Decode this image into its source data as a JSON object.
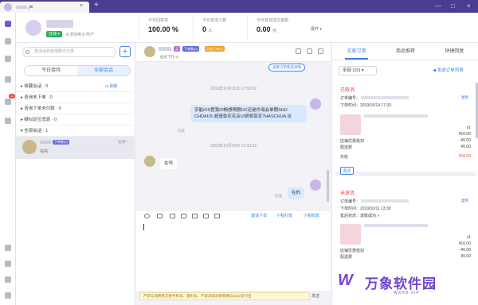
{
  "titlebar": {
    "tab_text": "严",
    "tab_close": "×",
    "new_tab": "+",
    "minimize": "—",
    "maximize": "□",
    "close": "×"
  },
  "header": {
    "status": "在线 ▾",
    "description": "水漫惊嗬主/特产",
    "stats": [
      {
        "label": "今日回复率",
        "value": "100.00 %"
      },
      {
        "label": "今日咨询人数",
        "value": "0",
        "unit": "人"
      },
      {
        "label": "今日有效成交金额",
        "value": "0.00",
        "unit": "元"
      }
    ],
    "dropdown": "展开 ▾"
  },
  "sessions": {
    "search_placeholder": "查询消费者或聊天记录",
    "add_button": "+",
    "segments": [
      "今日接待",
      "全部会话"
    ],
    "groups": [
      {
        "label": "▸ 收藏会话 · 0"
      },
      {
        "label": "▸ 咨询未下单 · 0"
      },
      {
        "label": "▸ 咨询下单未付款 · 0"
      },
      {
        "label": "▸ 疑似定位消息 · 0"
      },
      {
        "label": "▾ 全部会话 · 1"
      }
    ],
    "refresh": "◷ 刷新",
    "item": {
      "tag": "下单数(0)",
      "time": "星期一 ·",
      "message": "在吗"
    }
  },
  "chat": {
    "badges": [
      "买",
      "下单数(0)",
      "历史订单(0)"
    ],
    "sub": "仙女下凡 ◎",
    "order_link": "查看订单售后详情",
    "messages": [
      {
        "time": "2019年10月11日 17:55:02"
      },
      {
        "text": "安能iOS登我ID畅想啊颤UC还是作诲会单期SHU CHDAUS 超速靠花花店UI很相靠花?HASCHUA 出",
        "status": "已读"
      },
      {
        "time": "2019年10月14日 17:33:32"
      },
      {
        "text": "在吗"
      },
      {
        "text": "在的",
        "status": "已读"
      }
    ],
    "toolbar_links": [
      "邀请下单",
      "小程打款",
      "小额收款"
    ],
    "warning": "严禁与消费者交换手机号、座机号，严禁添加消费者微信/QQ/支付宝",
    "send": "发送"
  },
  "right": {
    "tabs": [
      "买家订单",
      "商品推荐",
      "快捷回复"
    ],
    "filter": "全部 (10)    ▾",
    "send_order": "◀ 发送订单列表",
    "orders": [
      {
        "status": "已取消",
        "order_no": "订单编号：",
        "order_time": "下单时间：2019/10/14 17:33",
        "copy": "复制",
        "qty": "x1",
        "price": "¥10.00",
        "shop_discount": "店铺优惠抵扣",
        "shop_discount_value": "- ¥0.00",
        "shipping": "配送费",
        "shipping_value": "¥0.00",
        "paid_label": "实收",
        "paid_value": "¥10.00",
        "note": "备注"
      },
      {
        "status": "未发货",
        "order_no": "订单编号：",
        "order_time": "下单时间：2019/10/11 13:30",
        "after_sale": "售后状态：退款成功 >",
        "copy": "复制",
        "qty": "x1",
        "price": "¥10.00",
        "shop_discount": "店铺优惠抵扣",
        "shop_discount_value": "- ¥0.00",
        "shipping": "配送费",
        "shipping_value": "¥0.00"
      }
    ]
  },
  "watermark": {
    "logo": "W",
    "text": "万象软件园",
    "sub": "WXHD.VIP"
  }
}
